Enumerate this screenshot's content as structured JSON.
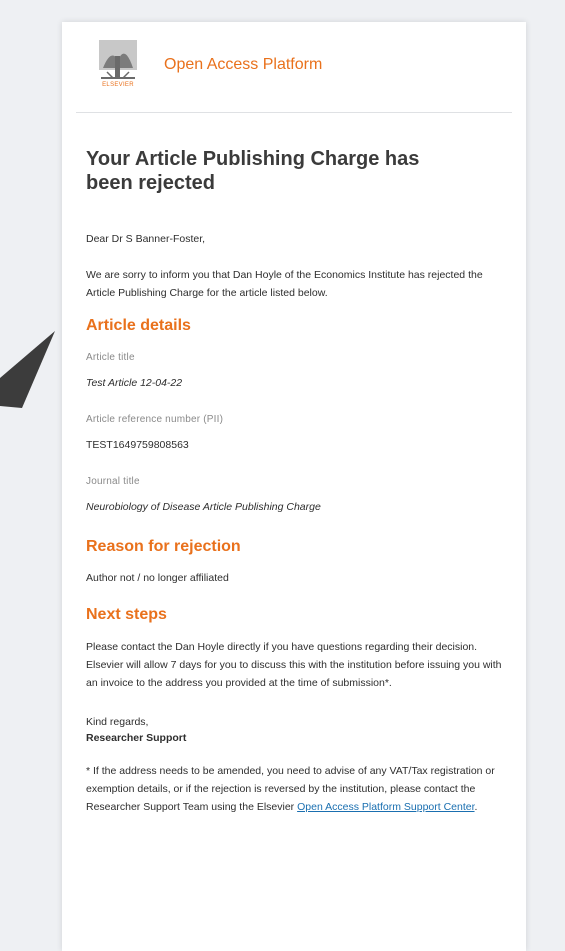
{
  "header": {
    "publisher_logo_text": "ELSEVIER",
    "platform_name": "Open Access Platform"
  },
  "email": {
    "title": "Your Article Publishing Charge has been rejected",
    "greeting": "Dear Dr S Banner-Foster,",
    "intro": "We are sorry to inform you that Dan Hoyle of the Economics Institute has rejected the Article Publishing Charge for the article listed below."
  },
  "article_details": {
    "heading": "Article details",
    "article_title_label": "Article title",
    "article_title_value": "Test Article 12-04-22",
    "reference_label": "Article reference number (PII)",
    "reference_value": "TEST1649759808563",
    "journal_label": "Journal title",
    "journal_value": "Neurobiology of Disease Article Publishing Charge"
  },
  "rejection": {
    "heading": "Reason for rejection",
    "reason": "Author not / no longer affiliated"
  },
  "next_steps": {
    "heading": "Next steps",
    "body": "Please contact the Dan Hoyle directly if you have questions regarding their decision. Elsevier will allow 7 days for you to discuss this with the institution before issuing you with an invoice to the address you provided at the time of submission*."
  },
  "closing": {
    "regards": "Kind regards,",
    "signature": "Researcher Support"
  },
  "footnote": {
    "text": "* If the address needs to be amended, you need to advise of any VAT/Tax registration or exemption details, or if the rejection is reversed by the institution, please contact the Researcher Support Team using the Elsevier",
    "link_text": "Open Access Platform Support Center",
    "end": "."
  },
  "colors": {
    "accent": "#e9711c",
    "link": "#1a6fb0",
    "pointer": "#3c3c3c"
  }
}
